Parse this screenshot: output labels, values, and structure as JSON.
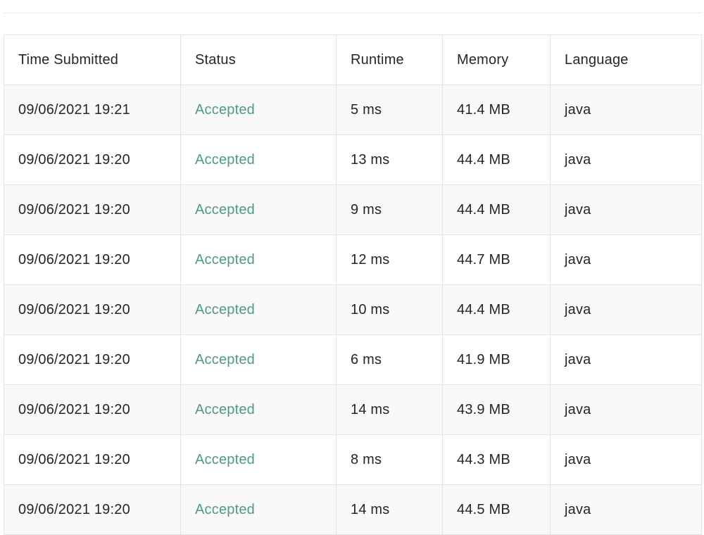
{
  "table": {
    "headers": [
      "Time Submitted",
      "Status",
      "Runtime",
      "Memory",
      "Language"
    ],
    "rows": [
      {
        "time": "09/06/2021 19:21",
        "status": "Accepted",
        "runtime": "5 ms",
        "memory": "41.4 MB",
        "language": "java"
      },
      {
        "time": "09/06/2021 19:20",
        "status": "Accepted",
        "runtime": "13 ms",
        "memory": "44.4 MB",
        "language": "java"
      },
      {
        "time": "09/06/2021 19:20",
        "status": "Accepted",
        "runtime": "9 ms",
        "memory": "44.4 MB",
        "language": "java"
      },
      {
        "time": "09/06/2021 19:20",
        "status": "Accepted",
        "runtime": "12 ms",
        "memory": "44.7 MB",
        "language": "java"
      },
      {
        "time": "09/06/2021 19:20",
        "status": "Accepted",
        "runtime": "10 ms",
        "memory": "44.4 MB",
        "language": "java"
      },
      {
        "time": "09/06/2021 19:20",
        "status": "Accepted",
        "runtime": "6 ms",
        "memory": "41.9 MB",
        "language": "java"
      },
      {
        "time": "09/06/2021 19:20",
        "status": "Accepted",
        "runtime": "14 ms",
        "memory": "43.9 MB",
        "language": "java"
      },
      {
        "time": "09/06/2021 19:20",
        "status": "Accepted",
        "runtime": "8 ms",
        "memory": "44.3 MB",
        "language": "java"
      },
      {
        "time": "09/06/2021 19:20",
        "status": "Accepted",
        "runtime": "14 ms",
        "memory": "44.5 MB",
        "language": "java"
      }
    ]
  },
  "colors": {
    "accepted": "#4f9a82",
    "text": "#262626",
    "border": "#e4e4e4",
    "row_alt": "#f9f9f9"
  }
}
